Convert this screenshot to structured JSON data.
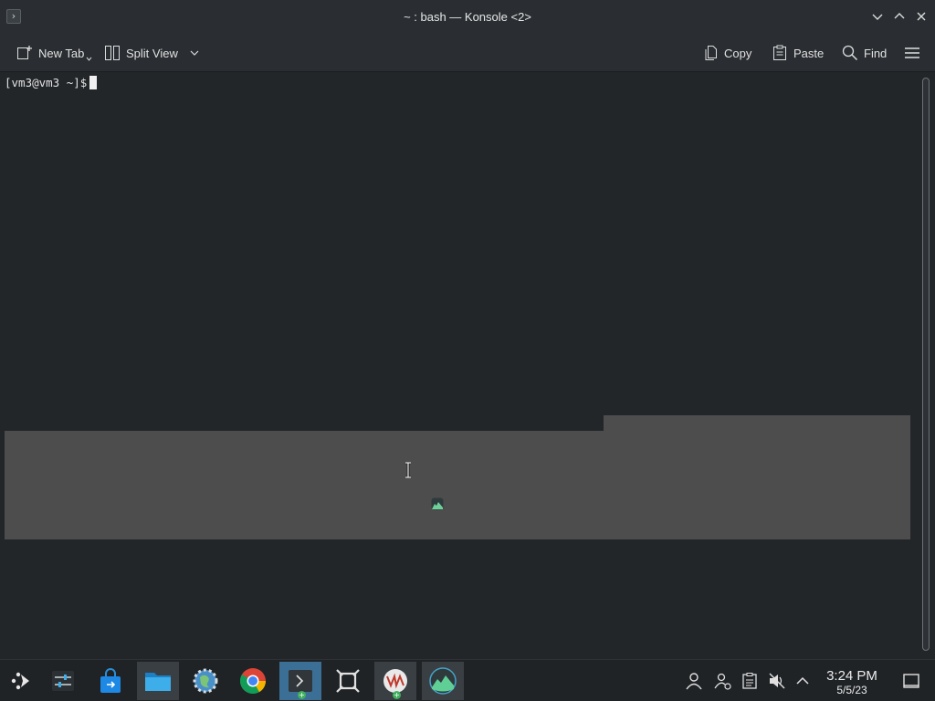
{
  "window": {
    "title": "~ : bash — Konsole <2>",
    "app_icon": "terminal-icon",
    "controls": [
      "minimize-icon",
      "maximize-icon",
      "close-icon"
    ]
  },
  "toolbar": {
    "new_tab": "New Tab",
    "split_view": "Split View",
    "copy": "Copy",
    "paste": "Paste",
    "find": "Find",
    "menu_icon": "hamburger-menu-icon"
  },
  "terminal": {
    "prompt": "[vm3@vm3 ~]$"
  },
  "taskbar": {
    "apps": [
      {
        "name": "application-launcher",
        "icon": "launcher-icon"
      },
      {
        "name": "task-manager",
        "icon": "sliders-icon"
      },
      {
        "name": "discover-store",
        "icon": "shopping-bag-icon"
      },
      {
        "name": "dolphin-files",
        "icon": "folder-icon"
      },
      {
        "name": "system-settings",
        "icon": "settings-globe-icon"
      },
      {
        "name": "google-chrome",
        "icon": "chrome-icon"
      },
      {
        "name": "konsole",
        "icon": "terminal-icon"
      },
      {
        "name": "window-manager",
        "icon": "window-frame-icon"
      },
      {
        "name": "vmware",
        "icon": "vm-icon"
      },
      {
        "name": "system-monitor",
        "icon": "monitor-icon"
      }
    ],
    "tray": [
      "user-icon",
      "network-user-icon",
      "clipboard-icon",
      "volume-muted-icon",
      "chevron-up-icon"
    ],
    "clock": {
      "time": "3:24 PM",
      "date": "5/5/23"
    },
    "show_desktop": "show-desktop-icon"
  }
}
